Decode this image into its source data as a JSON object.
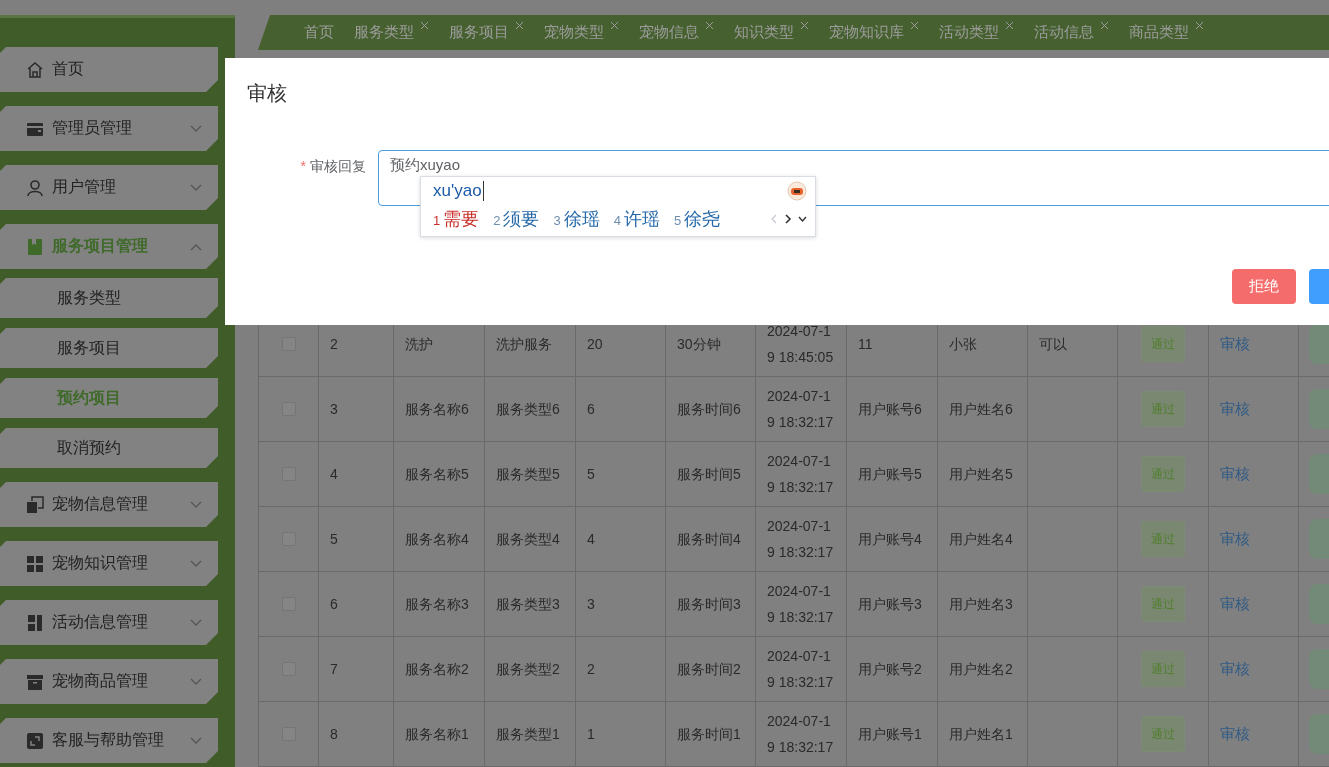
{
  "sidebar": {
    "items": [
      {
        "label": "首页",
        "selected": false
      },
      {
        "label": "管理员管理",
        "selected": false,
        "expanded": false
      },
      {
        "label": "用户管理",
        "selected": false,
        "expanded": false
      },
      {
        "label": "服务项目管理",
        "selected": true,
        "expanded": true,
        "children": [
          {
            "label": "服务类型",
            "selected": false
          },
          {
            "label": "服务项目",
            "selected": false
          },
          {
            "label": "预约项目",
            "selected": true
          },
          {
            "label": "取消预约",
            "selected": false
          }
        ]
      },
      {
        "label": "宠物信息管理",
        "selected": false,
        "expanded": false
      },
      {
        "label": "宠物知识管理",
        "selected": false,
        "expanded": false
      },
      {
        "label": "活动信息管理",
        "selected": false,
        "expanded": false
      },
      {
        "label": "宠物商品管理",
        "selected": false,
        "expanded": false
      },
      {
        "label": "客服与帮助管理",
        "selected": false,
        "expanded": false
      }
    ]
  },
  "tabs": [
    {
      "label": "首页",
      "closable": false
    },
    {
      "label": "服务类型",
      "closable": true
    },
    {
      "label": "服务项目",
      "closable": true
    },
    {
      "label": "宠物类型",
      "closable": true
    },
    {
      "label": "宠物信息",
      "closable": true
    },
    {
      "label": "知识类型",
      "closable": true
    },
    {
      "label": "宠物知识库",
      "closable": true
    },
    {
      "label": "活动类型",
      "closable": true
    },
    {
      "label": "活动信息",
      "closable": true
    },
    {
      "label": "商品类型",
      "closable": true
    }
  ],
  "table": {
    "rows": [
      {
        "checked": false,
        "cells": [
          "2",
          "洗护",
          "洗护服务",
          "20",
          "30分钟",
          "2024-07-19 18:45:05",
          "11",
          "小张",
          "可以"
        ],
        "status": "通过",
        "action": "审核"
      },
      {
        "checked": false,
        "cells": [
          "3",
          "服务名称6",
          "服务类型6",
          "6",
          "服务时间6",
          "2024-07-19 18:32:17",
          "用户账号6",
          "用户姓名6",
          ""
        ],
        "status": "通过",
        "action": "审核"
      },
      {
        "checked": false,
        "cells": [
          "4",
          "服务名称5",
          "服务类型5",
          "5",
          "服务时间5",
          "2024-07-19 18:32:17",
          "用户账号5",
          "用户姓名5",
          ""
        ],
        "status": "通过",
        "action": "审核"
      },
      {
        "checked": false,
        "cells": [
          "5",
          "服务名称4",
          "服务类型4",
          "4",
          "服务时间4",
          "2024-07-19 18:32:17",
          "用户账号4",
          "用户姓名4",
          ""
        ],
        "status": "通过",
        "action": "审核"
      },
      {
        "checked": false,
        "cells": [
          "6",
          "服务名称3",
          "服务类型3",
          "3",
          "服务时间3",
          "2024-07-19 18:32:17",
          "用户账号3",
          "用户姓名3",
          ""
        ],
        "status": "通过",
        "action": "审核"
      },
      {
        "checked": false,
        "cells": [
          "7",
          "服务名称2",
          "服务类型2",
          "2",
          "服务时间2",
          "2024-07-19 18:32:17",
          "用户账号2",
          "用户姓名2",
          ""
        ],
        "status": "通过",
        "action": "审核"
      },
      {
        "checked": false,
        "cells": [
          "8",
          "服务名称1",
          "服务类型1",
          "1",
          "服务时间1",
          "2024-07-19 18:32:17",
          "用户账号1",
          "用户姓名1",
          ""
        ],
        "status": "通过",
        "action": "审核"
      }
    ]
  },
  "dialog": {
    "title": "审核",
    "field": {
      "required_mark": "*",
      "label": "审核回复",
      "value": "预约xuyao"
    },
    "ime": {
      "composition": "xu'yao",
      "candidates": [
        {
          "index": "1",
          "text": "需要",
          "selected": true
        },
        {
          "index": "2",
          "text": "须要",
          "selected": false
        },
        {
          "index": "3",
          "text": "徐瑶",
          "selected": false
        },
        {
          "index": "4",
          "text": "许瑶",
          "selected": false
        },
        {
          "index": "5",
          "text": "徐尧",
          "selected": false
        }
      ]
    },
    "buttons": [
      {
        "label": "拒绝",
        "kind": "danger"
      },
      {
        "kind": "primary"
      }
    ]
  }
}
